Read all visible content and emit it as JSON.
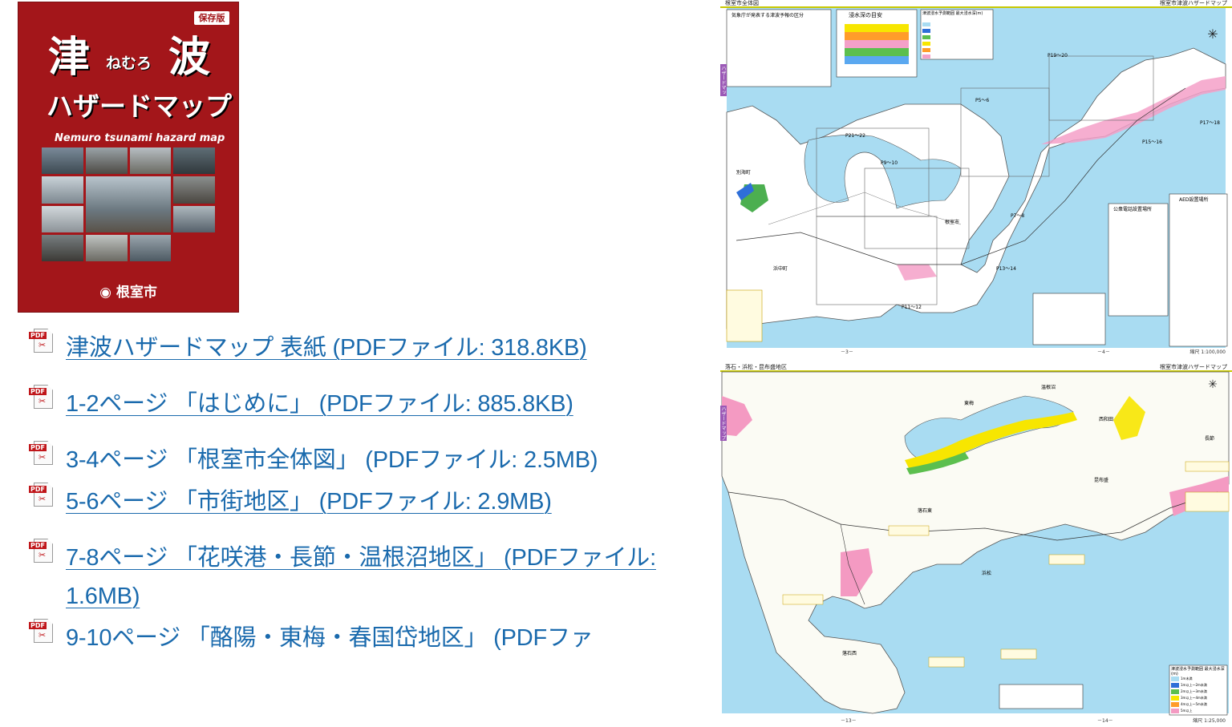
{
  "cover": {
    "badge": "保存版",
    "title_char1": "津",
    "title_small": "ねむろ",
    "title_char2": "波",
    "subtitle": "ハザードマップ",
    "english": "Nemuro tsunami hazard map",
    "city": "根室市",
    "bg_color": "#a3161a"
  },
  "links": [
    {
      "icon": "pdf-icon",
      "text": "津波ハザードマップ 表紙 (PDFファイル: 318.8KB)"
    },
    {
      "icon": "pdf-icon",
      "text": "1-2ページ 「はじめに」 (PDFファイル: 885.8KB)"
    },
    {
      "icon": "pdf-icon",
      "text": "3-4ページ 「根室市全体図」 (PDFファイル: 2.5MB)"
    },
    {
      "icon": "pdf-icon",
      "text": "5-6ページ 「市街地区」 (PDFファイル: 2.9MB)"
    },
    {
      "icon": "pdf-icon",
      "text": "7-8ページ 「花咲港・長節・温根沼地区」 (PDFファイル: 1.6MB)"
    },
    {
      "icon": "pdf-icon",
      "text": "9-10ページ 「酪陽・東梅・春国岱地区」 (PDFファ"
    }
  ],
  "map1": {
    "header_left": "根室市全体図",
    "header_right": "根室市津波ハザードマップ",
    "side_tab": "ハザードマップ",
    "legend_title": "浸水深の目安",
    "legend2_title": "津波浸水予測範囲 最大浸水深(m)",
    "alert_title": "気象庁が発表する津波予報の区分",
    "aed_title": "AED設置場所",
    "phone_title": "公衆電話設置場所",
    "places": [
      "別海町",
      "浜中町",
      "根室市"
    ],
    "pages": [
      "P19～20",
      "P5～6",
      "P21～22",
      "P9～10",
      "P7～8",
      "P15～16",
      "P17～18",
      "P13～14",
      "P11～12"
    ],
    "footer_left": "－3－",
    "footer_right": "－4－",
    "scale": "縮尺 1:100,000",
    "colors": {
      "sea": "#a9dcf2",
      "land": "#ffffff",
      "flood_pink": "#f4a0c8",
      "flood_green": "#4caf50",
      "flood_blue": "#2e6fd8"
    }
  },
  "map2": {
    "header_left": "落石・浜松・昆布盛地区",
    "header_right": "根室市津波ハザードマップ",
    "side_tab": "ハザードマップ",
    "places": [
      "東梅",
      "温根沼",
      "西和田",
      "長節",
      "昆布盛",
      "落石東",
      "浜松",
      "落石西"
    ],
    "legend_title": "津波浸水予測範囲 最大浸水深(m)",
    "legend_rows": [
      "1m未満",
      "1m以上～2m未満",
      "2m以上～3m未満",
      "3m以上～4m未満",
      "4m以上～5m未満",
      "5m以上"
    ],
    "footer_left": "－13－",
    "footer_right": "－14－",
    "scale": "縮尺 1:25,000",
    "colors": {
      "sea": "#a9dcf2",
      "land": "#fbfbf4",
      "flood_pink": "#f49ac2",
      "flood_yellow": "#f7e600",
      "flood_green": "#5cbf4e"
    }
  }
}
